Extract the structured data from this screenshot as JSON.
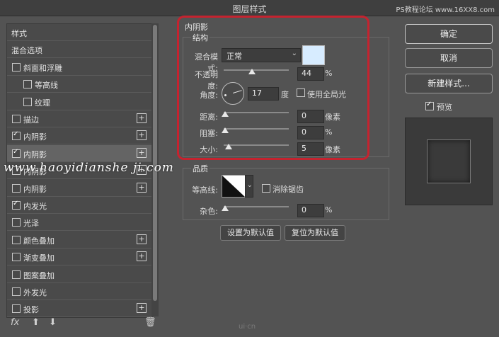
{
  "window": {
    "title": "图层样式",
    "watermark_top": "PS教程论坛 www.16XX8.com"
  },
  "left_panel": {
    "items": [
      {
        "label": "样式",
        "checkbox": false,
        "checked": false,
        "plus": false,
        "indent": 0
      },
      {
        "label": "混合选项",
        "checkbox": false,
        "checked": false,
        "plus": false,
        "indent": 0
      },
      {
        "label": "斜面和浮雕",
        "checkbox": true,
        "checked": false,
        "plus": false,
        "indent": 0
      },
      {
        "label": "等高线",
        "checkbox": true,
        "checked": false,
        "plus": false,
        "indent": 1
      },
      {
        "label": "纹理",
        "checkbox": true,
        "checked": false,
        "plus": false,
        "indent": 1
      },
      {
        "label": "描边",
        "checkbox": true,
        "checked": false,
        "plus": true,
        "indent": 0
      },
      {
        "label": "内阴影",
        "checkbox": true,
        "checked": true,
        "plus": true,
        "indent": 0
      },
      {
        "label": "内阴影",
        "checkbox": true,
        "checked": true,
        "plus": true,
        "indent": 0,
        "selected": true
      },
      {
        "label": "内阴影",
        "checkbox": true,
        "checked": false,
        "plus": true,
        "indent": 0
      },
      {
        "label": "内阴影",
        "checkbox": true,
        "checked": false,
        "plus": true,
        "indent": 0
      },
      {
        "label": "内发光",
        "checkbox": true,
        "checked": true,
        "plus": false,
        "indent": 0
      },
      {
        "label": "光泽",
        "checkbox": true,
        "checked": false,
        "plus": false,
        "indent": 0
      },
      {
        "label": "颜色叠加",
        "checkbox": true,
        "checked": false,
        "plus": true,
        "indent": 0
      },
      {
        "label": "渐变叠加",
        "checkbox": true,
        "checked": false,
        "plus": true,
        "indent": 0
      },
      {
        "label": "图案叠加",
        "checkbox": true,
        "checked": false,
        "plus": false,
        "indent": 0
      },
      {
        "label": "外发光",
        "checkbox": true,
        "checked": false,
        "plus": false,
        "indent": 0
      },
      {
        "label": "投影",
        "checkbox": true,
        "checked": false,
        "plus": true,
        "indent": 0
      }
    ],
    "bottom_tools": {
      "fx": "fx",
      "up": "⬆",
      "down": "⬇",
      "trash": "🗑"
    }
  },
  "inner_shadow": {
    "section_title": "内阴影",
    "structure_title": "结构",
    "blend_mode_label": "混合模式:",
    "blend_mode_value": "正常",
    "swatch_color": "#d7ecff",
    "opacity_label": "不透明度:",
    "opacity_value": "44",
    "opacity_unit": "%",
    "angle_label": "角度:",
    "angle_value": "17",
    "angle_unit": "度",
    "global_light_label": "使用全局光",
    "global_light_checked": false,
    "distance_label": "距离:",
    "distance_value": "0",
    "distance_unit": "像素",
    "choke_label": "阻塞:",
    "choke_value": "0",
    "choke_unit": "%",
    "size_label": "大小:",
    "size_value": "5",
    "size_unit": "像素"
  },
  "quality": {
    "title": "品质",
    "contour_label": "等高线:",
    "antialias_label": "消除锯齿",
    "antialias_checked": false,
    "noise_label": "杂色:",
    "noise_value": "0",
    "noise_unit": "%"
  },
  "defaults": {
    "make_default": "设置为默认值",
    "reset_default": "复位为默认值"
  },
  "right_panel": {
    "ok": "确定",
    "cancel": "取消",
    "new_style": "新建样式...",
    "preview_label": "预览",
    "preview_checked": true
  },
  "watermark_mid": "www.haoyidianshe ji.com",
  "watermark_bottom": "ui·cn"
}
